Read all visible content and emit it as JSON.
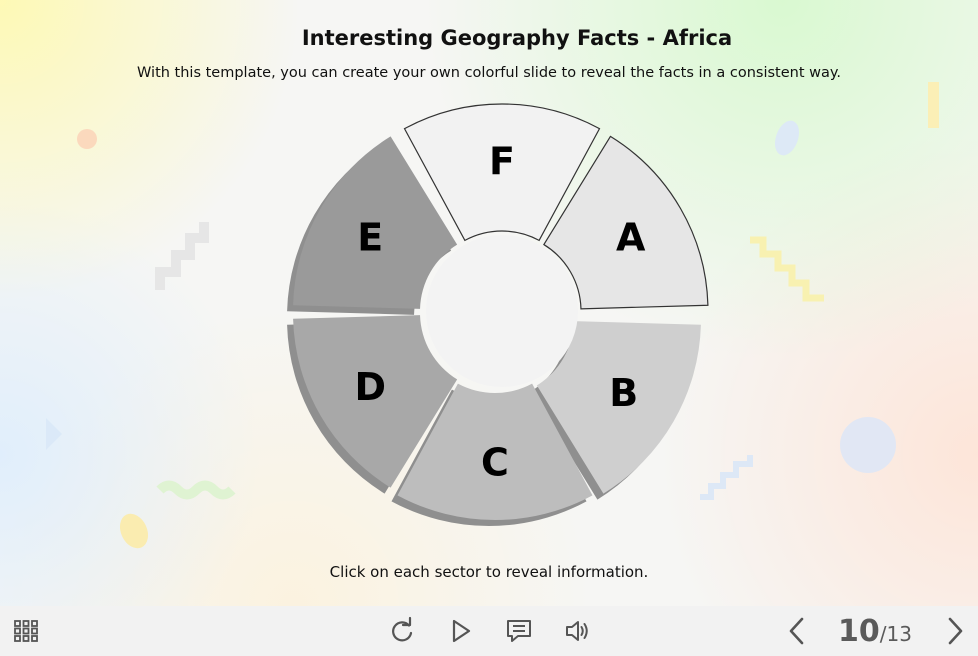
{
  "slide": {
    "title": "Interesting Geography Facts - Africa",
    "subtitle": "With this template, you can create your own colorful slide to reveal the facts in a consistent way.",
    "instruction": "Click on each sector to reveal information."
  },
  "wheel": {
    "sectors": [
      {
        "label": "A",
        "color": "#e6e6e6"
      },
      {
        "label": "B",
        "color": "#cfcfcf"
      },
      {
        "label": "C",
        "color": "#bdbdbd"
      },
      {
        "label": "D",
        "color": "#a8a8a8"
      },
      {
        "label": "E",
        "color": "#9a9a9a"
      },
      {
        "label": "F",
        "color": "#f2f2f2"
      }
    ]
  },
  "toolbar": {
    "menu_icon": "grid-menu-icon",
    "replay_icon": "replay-icon",
    "play_icon": "play-icon",
    "notes_icon": "notes-icon",
    "volume_icon": "volume-icon",
    "prev_icon": "chevron-left-icon",
    "next_icon": "chevron-right-icon",
    "page_current": "10",
    "page_separator": "/",
    "page_total": "13"
  },
  "colors": {
    "toolbar_icon": "#555555",
    "text": "#111111",
    "outline": "#333333"
  }
}
